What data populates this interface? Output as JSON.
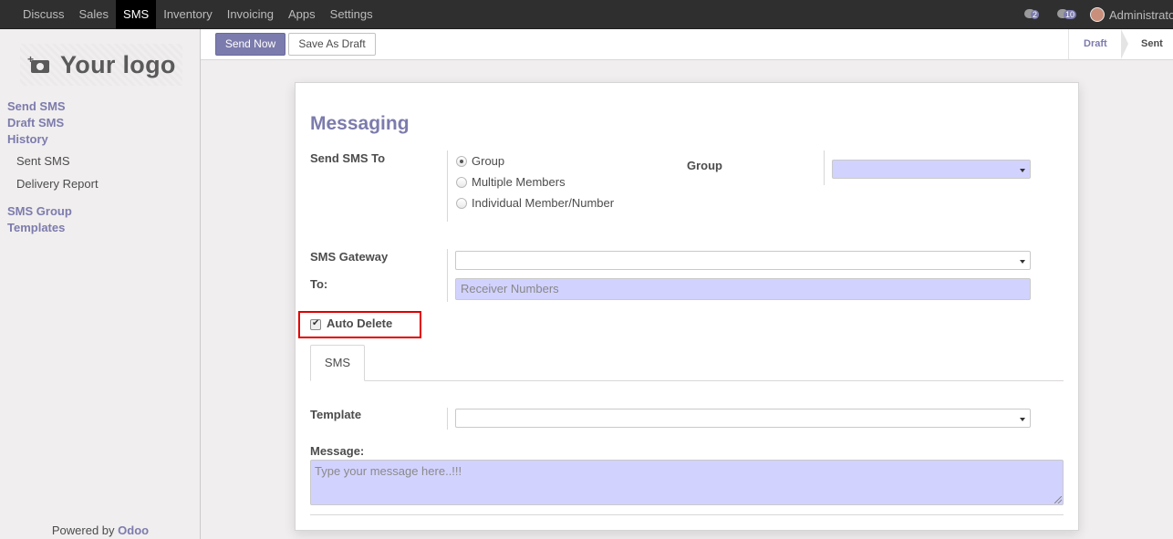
{
  "topbar": {
    "menu": [
      "Discuss",
      "Sales",
      "SMS",
      "Inventory",
      "Invoicing",
      "Apps",
      "Settings"
    ],
    "active_menu": "SMS",
    "chat_badge": "2",
    "messages_badge": "10",
    "user_name": "Administrator"
  },
  "sidebar": {
    "logo_text": "Your logo",
    "groups": {
      "send_sms": "Send SMS",
      "draft_sms": "Draft SMS",
      "history": "History",
      "sent_sms": "Sent SMS",
      "delivery_report": "Delivery Report",
      "sms_group": "SMS Group",
      "templates": "Templates"
    },
    "powered_by": "Powered by",
    "powered_brand": "Odoo"
  },
  "control_panel": {
    "send_now": "Send Now",
    "save_as_draft": "Save As Draft",
    "stages": [
      "Draft",
      "Sent"
    ],
    "current_stage": "Sent"
  },
  "form": {
    "title": "Messaging",
    "send_sms_to_label": "Send SMS To",
    "options": [
      "Group",
      "Multiple Members",
      "Individual Member/Number"
    ],
    "selected_option": "Group",
    "group_label": "Group",
    "group_value": "",
    "sms_gateway_label": "SMS Gateway",
    "sms_gateway_value": "",
    "to_label": "To:",
    "to_placeholder": "Receiver Numbers",
    "auto_delete_label": "Auto Delete",
    "auto_delete_checked": true,
    "tab_label": "SMS",
    "template_label": "Template",
    "template_value": "",
    "message_label": "Message:",
    "message_placeholder": "Type your message here..!!!"
  },
  "colors": {
    "brand": "#7c7bad",
    "required_field": "#d2d2ff",
    "highlight_border": "#e00000"
  }
}
